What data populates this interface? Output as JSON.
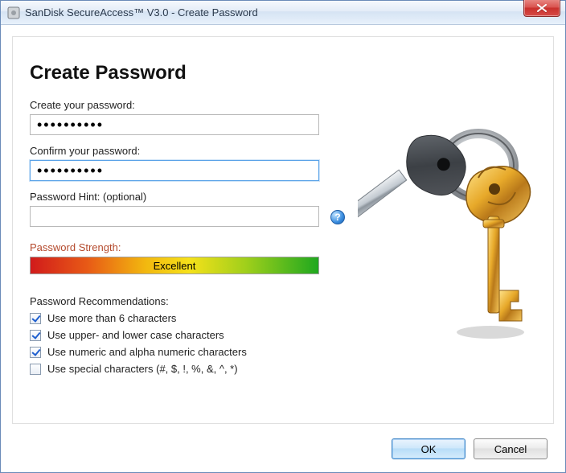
{
  "window": {
    "title": "SanDisk SecureAccess™ V3.0 - Create Password"
  },
  "page_heading": "Create Password",
  "fields": {
    "create_label": "Create your password:",
    "create_value": "••••••••••",
    "confirm_label": "Confirm your password:",
    "confirm_value": "••••••••••",
    "hint_label": "Password Hint: (optional)",
    "hint_value": ""
  },
  "help_icon_glyph": "?",
  "strength": {
    "label": "Password Strength:",
    "value_text": "Excellent"
  },
  "recommendations": {
    "label": "Password Recommendations:",
    "items": [
      {
        "label": "Use more than 6 characters",
        "checked": true
      },
      {
        "label": "Use upper- and lower case characters",
        "checked": true
      },
      {
        "label": "Use numeric and alpha numeric characters",
        "checked": true
      },
      {
        "label": "Use special characters (#, $, !, %, &, ^, *)",
        "checked": false
      }
    ]
  },
  "buttons": {
    "ok": "OK",
    "cancel": "Cancel"
  }
}
